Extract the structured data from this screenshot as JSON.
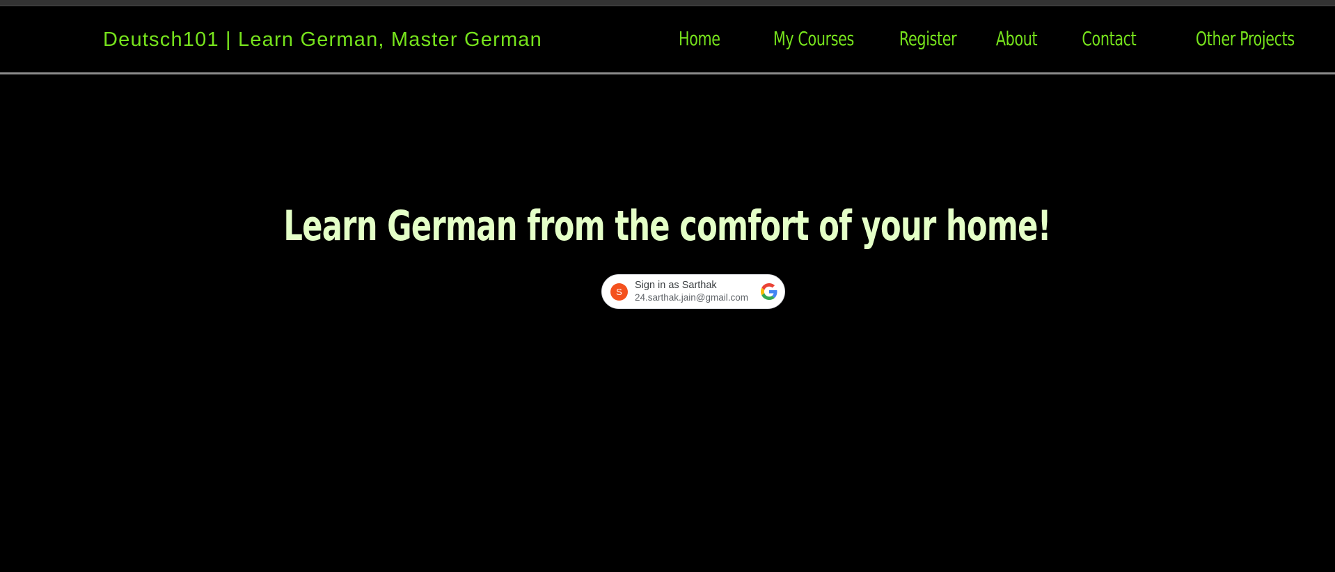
{
  "header": {
    "brand": "Deutsch101 | Learn German, Master German",
    "nav": [
      {
        "label": "Home"
      },
      {
        "label": "My Courses"
      },
      {
        "label": "Register"
      },
      {
        "label": "About"
      },
      {
        "label": "Contact"
      },
      {
        "label": "Other Projects"
      }
    ]
  },
  "hero": {
    "title": "Learn German from the comfort of your home!"
  },
  "google_signin": {
    "avatar_letter": "S",
    "label": "Sign in as Sarthak",
    "email": "24.sarthak.jain@gmail.com",
    "icon": "google-g-icon"
  },
  "colors": {
    "background": "#000000",
    "accent_green": "#76e21c",
    "hero_text": "#e4ffc7",
    "avatar": "#f4511e"
  }
}
